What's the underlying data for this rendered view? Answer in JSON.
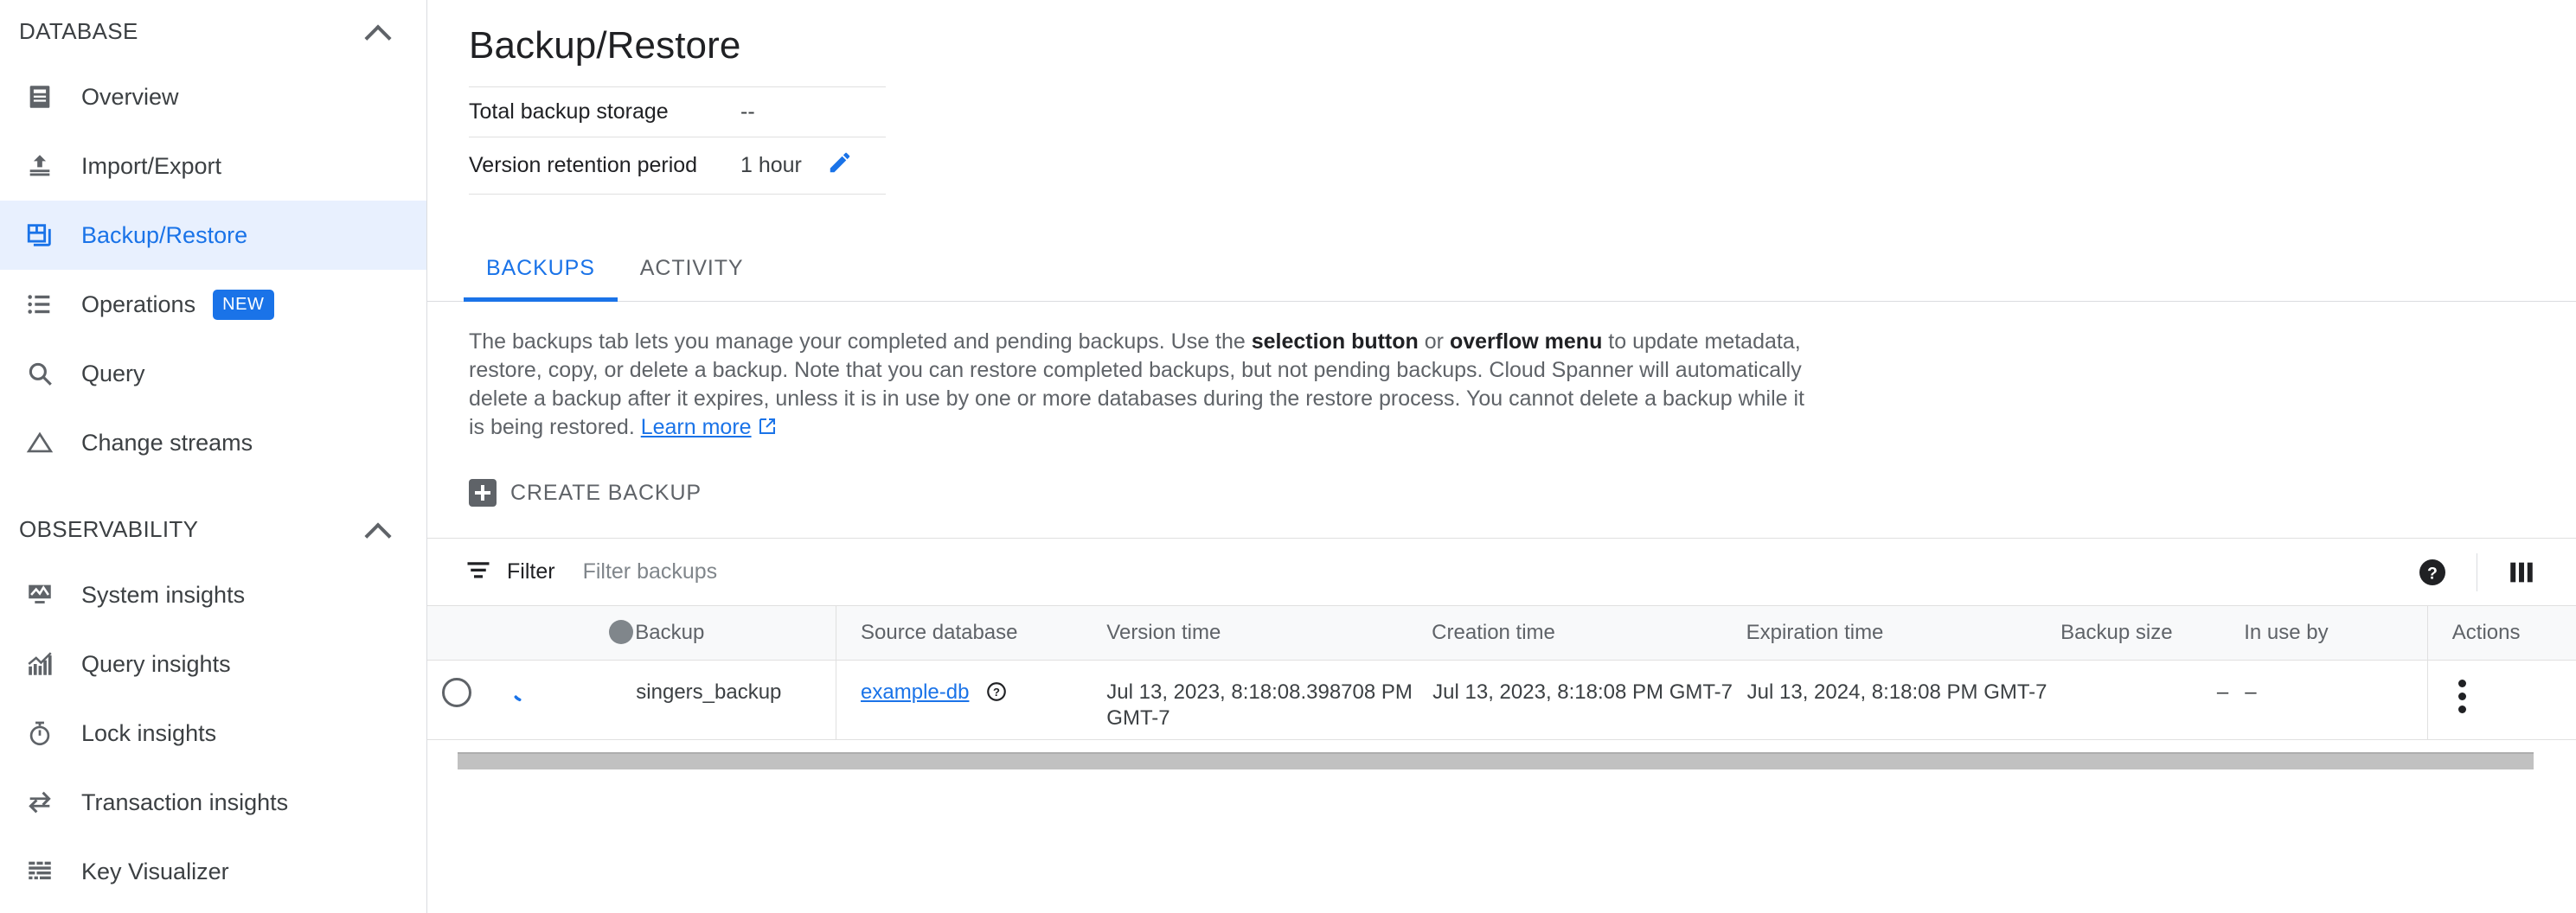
{
  "sidebar": {
    "sections": [
      {
        "title": "DATABASE",
        "collapse_icon": "chevron-up-icon",
        "items": [
          {
            "label": "Overview",
            "icon": "database-overview-icon",
            "active": false
          },
          {
            "label": "Import/Export",
            "icon": "import-export-icon",
            "active": false
          },
          {
            "label": "Backup/Restore",
            "icon": "backup-restore-icon",
            "active": true
          },
          {
            "label": "Operations",
            "icon": "list-icon",
            "active": false,
            "badge": "NEW"
          },
          {
            "label": "Query",
            "icon": "search-icon",
            "active": false
          },
          {
            "label": "Change streams",
            "icon": "triangle-icon",
            "active": false
          }
        ]
      },
      {
        "title": "OBSERVABILITY",
        "collapse_icon": "chevron-up-icon",
        "items": [
          {
            "label": "System insights",
            "icon": "monitor-chart-icon",
            "active": false
          },
          {
            "label": "Query insights",
            "icon": "bar-chart-icon",
            "active": false
          },
          {
            "label": "Lock insights",
            "icon": "stopwatch-icon",
            "active": false
          },
          {
            "label": "Transaction insights",
            "icon": "swap-arrows-icon",
            "active": false
          },
          {
            "label": "Key Visualizer",
            "icon": "heatmap-grid-icon",
            "active": false
          }
        ]
      }
    ]
  },
  "page": {
    "title": "Backup/Restore",
    "meta": [
      {
        "key": "Total backup storage",
        "value": "--",
        "editable": false
      },
      {
        "key": "Version retention period",
        "value": "1 hour",
        "editable": true,
        "edit_icon": "pencil-icon"
      }
    ]
  },
  "tabs": [
    {
      "label": "BACKUPS",
      "active": true
    },
    {
      "label": "ACTIVITY",
      "active": false
    }
  ],
  "description": {
    "p1": "The backups tab lets you manage your completed and pending backups. Use the ",
    "b1": "selection button",
    "p2": " or ",
    "b2": "overflow menu",
    "p3": " to update metadata, restore, copy, or delete a backup. Note that you can restore completed backups, but not pending backups. Cloud Spanner will automatically delete a backup after it expires, unless it is in use by one or more databases during the restore process. You cannot delete a backup while it is being restored. ",
    "link": "Learn more",
    "link_icon": "external-link-icon"
  },
  "toolbar": {
    "create_backup_label": "CREATE BACKUP",
    "create_backup_icon": "plus-box-icon"
  },
  "filter": {
    "icon": "filter-icon",
    "label": "Filter",
    "placeholder": "Filter backups",
    "value": "",
    "help_icon": "help-filled-icon",
    "columns_icon": "column-settings-icon"
  },
  "table": {
    "columns": [
      {
        "key": "select",
        "label": ""
      },
      {
        "key": "spinner",
        "label": ""
      },
      {
        "key": "status",
        "label": "",
        "icon": "status-dot-icon"
      },
      {
        "key": "backup",
        "label": "Backup"
      },
      {
        "key": "source",
        "label": "Source database"
      },
      {
        "key": "version",
        "label": "Version time"
      },
      {
        "key": "created",
        "label": "Creation time"
      },
      {
        "key": "expires",
        "label": "Expiration time"
      },
      {
        "key": "size",
        "label": "Backup size"
      },
      {
        "key": "inuse",
        "label": "In use by"
      },
      {
        "key": "actions",
        "label": "Actions"
      }
    ],
    "rows": [
      {
        "selected": false,
        "spinner": true,
        "backup": "singers_backup",
        "source": "example-db",
        "source_help_icon": "help-outline-icon",
        "version": "Jul 13, 2023, 8:18:08.398708 PM GMT-7",
        "created": "Jul 13, 2023, 8:18:08 PM GMT-7",
        "expires": "Jul 13, 2024, 8:18:08 PM GMT-7",
        "size": "–",
        "inuse": "–",
        "actions_icon": "overflow-menu-icon"
      }
    ]
  },
  "colors": {
    "accent": "#1a73e8",
    "active_nav_bg": "#e8f0fe",
    "text_primary": "#202124",
    "text_secondary": "#5f6368",
    "border": "#e0e0e0",
    "header_bg": "#f8f9fa",
    "scrollbar": "#c1c1c1"
  }
}
